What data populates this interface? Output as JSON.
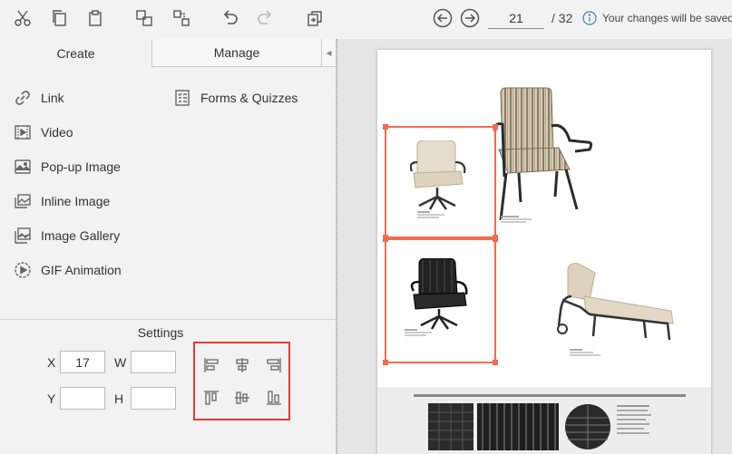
{
  "toolbar": {
    "items": [
      {
        "name": "cut-icon"
      },
      {
        "name": "copy-icon"
      },
      {
        "name": "paste-icon"
      },
      {
        "name": "group-icon"
      },
      {
        "name": "ungroup-icon"
      },
      {
        "name": "undo-icon"
      },
      {
        "name": "redo-icon"
      },
      {
        "name": "replace-page-icon"
      }
    ],
    "prev_page_icon": "arrow-left-circle-icon",
    "next_page_icon": "arrow-right-circle-icon",
    "page_current": "21",
    "page_total": "/ 32",
    "status": "Your changes will be saved"
  },
  "tabs": {
    "create": "Create",
    "manage": "Manage",
    "collapse": "◀"
  },
  "tools": [
    {
      "label": "Link",
      "icon": "link-icon"
    },
    {
      "label": "Video",
      "icon": "video-icon"
    },
    {
      "label": "Pop-up Image",
      "icon": "image-icon"
    },
    {
      "label": "Inline Image",
      "icon": "inline-image-icon"
    },
    {
      "label": "Image Gallery",
      "icon": "gallery-icon"
    },
    {
      "label": "GIF Animation",
      "icon": "gif-icon"
    },
    {
      "label": "Forms & Quizzes",
      "icon": "form-icon"
    }
  ],
  "settings": {
    "title": "Settings",
    "x_label": "X",
    "x_value": "17",
    "y_label": "Y",
    "y_value": "",
    "w_label": "W",
    "w_value": "",
    "h_label": "H",
    "h_value": ""
  },
  "align_buttons": [
    "align-left-icon",
    "align-center-horizontal-icon",
    "align-right-icon",
    "align-top-icon",
    "align-middle-vertical-icon",
    "align-bottom-icon"
  ],
  "colors": {
    "selection": "#f26b4f",
    "highlight_box": "#e53935"
  }
}
